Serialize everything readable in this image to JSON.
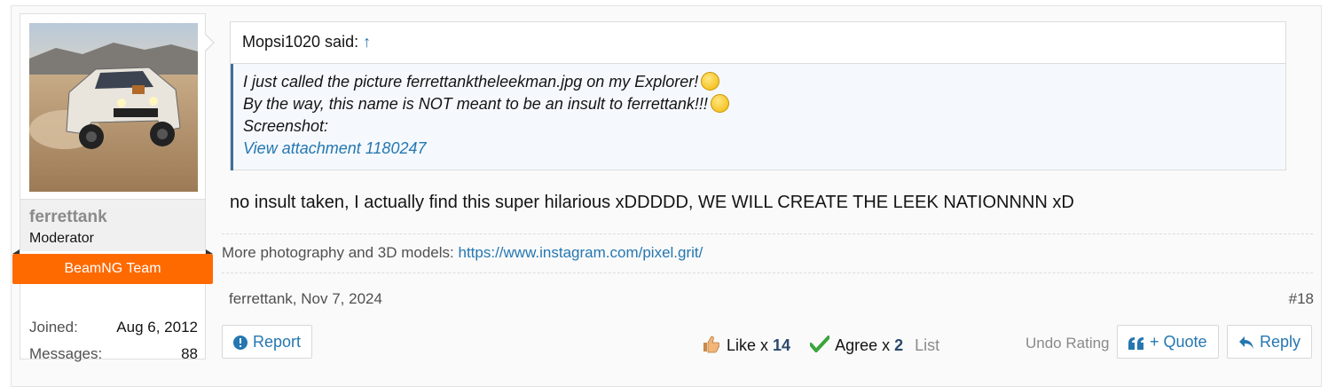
{
  "user": {
    "username": "ferrettank",
    "title": "Moderator",
    "banner": "BeamNG Team",
    "stats": [
      {
        "label": "Joined:",
        "value": "Aug 6, 2012"
      },
      {
        "label": "Messages:",
        "value": "88"
      }
    ]
  },
  "quote": {
    "author": "Mopsi1020 said:",
    "jump": "↑",
    "lines": [
      "I just called the picture ferrettanktheleekman.jpg on my Explorer!",
      "By the way, this name is NOT meant to be an insult to ferrettank!!!",
      "Screenshot:"
    ],
    "attachment": "View attachment 1180247"
  },
  "message": "no insult taken, I actually find this super hilarious xDDDDD, WE WILL CREATE THE LEEK NATIONNNN xD",
  "signature": {
    "text": "More photography and 3D models: ",
    "link": "https://www.instagram.com/pixel.grit/"
  },
  "meta": {
    "author_date": "ferrettank, Nov 7, 2024",
    "post_number": "#18"
  },
  "actions": {
    "report": "Report",
    "like_label": "Like x ",
    "like_count": "14",
    "agree_label": "Agree x ",
    "agree_count": "2",
    "list": "List",
    "undo": "Undo Rating",
    "quote": "+ Quote",
    "reply": "Reply"
  },
  "colors": {
    "link": "#2577b1",
    "banner": "#ff6a00",
    "quote_bg": "#f5f9fd"
  }
}
